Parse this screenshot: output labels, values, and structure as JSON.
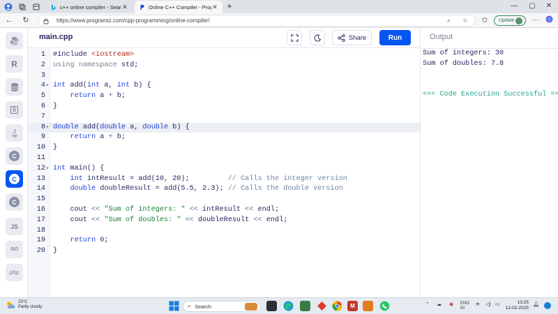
{
  "browser": {
    "tabs": [
      {
        "title": "c++ online compiler - Search"
      },
      {
        "title": "Online C++ Compiler - Programiz"
      }
    ],
    "url": "https://www.programiz.com/cpp-programming/online-compiler/",
    "update_label": "Update"
  },
  "rail": {
    "items": [
      {
        "name": "python",
        "label": ""
      },
      {
        "name": "r",
        "label": "R"
      },
      {
        "name": "sql",
        "label": ""
      },
      {
        "name": "html5",
        "label": "5"
      },
      {
        "name": "java",
        "label": ""
      },
      {
        "name": "c",
        "label": "C"
      },
      {
        "name": "cpp",
        "label": "C"
      },
      {
        "name": "csharp",
        "label": "C"
      },
      {
        "name": "javascript",
        "label": "JS"
      },
      {
        "name": "go",
        "label": "GO"
      },
      {
        "name": "php",
        "label": "php"
      }
    ]
  },
  "editor": {
    "filename": "main.cpp",
    "share_label": "Share",
    "run_label": "Run",
    "highlighted_line": 8,
    "lines": [
      "#include <iostream>",
      "using namespace std;",
      "",
      "int add(int a, int b) {",
      "    return a + b;",
      "}",
      "",
      "double add(double a, double b) {",
      "    return a + b;",
      "}",
      "",
      "int main() {",
      "    int intResult = add(10, 20);         // Calls the integer version",
      "    double doubleResult = add(5.5, 2.3); // Calls the double version",
      "",
      "    cout << \"Sum of integers: \" << intResult << endl;",
      "    cout << \"Sum of doubles: \" << doubleResult << endl;",
      "",
      "    return 0;",
      "}"
    ]
  },
  "output": {
    "title": "Output",
    "lines": [
      "Sum of integers: 30",
      "Sum of doubles: 7.8",
      "",
      "",
      "=== Code Execution Successful ==="
    ]
  },
  "taskbar": {
    "temperature": "23°C",
    "weather": "Partly cloudy",
    "search_placeholder": "Search",
    "lang_1": "ENG",
    "lang_2": "IN",
    "time": "13:25",
    "date": "12-02-2025"
  }
}
